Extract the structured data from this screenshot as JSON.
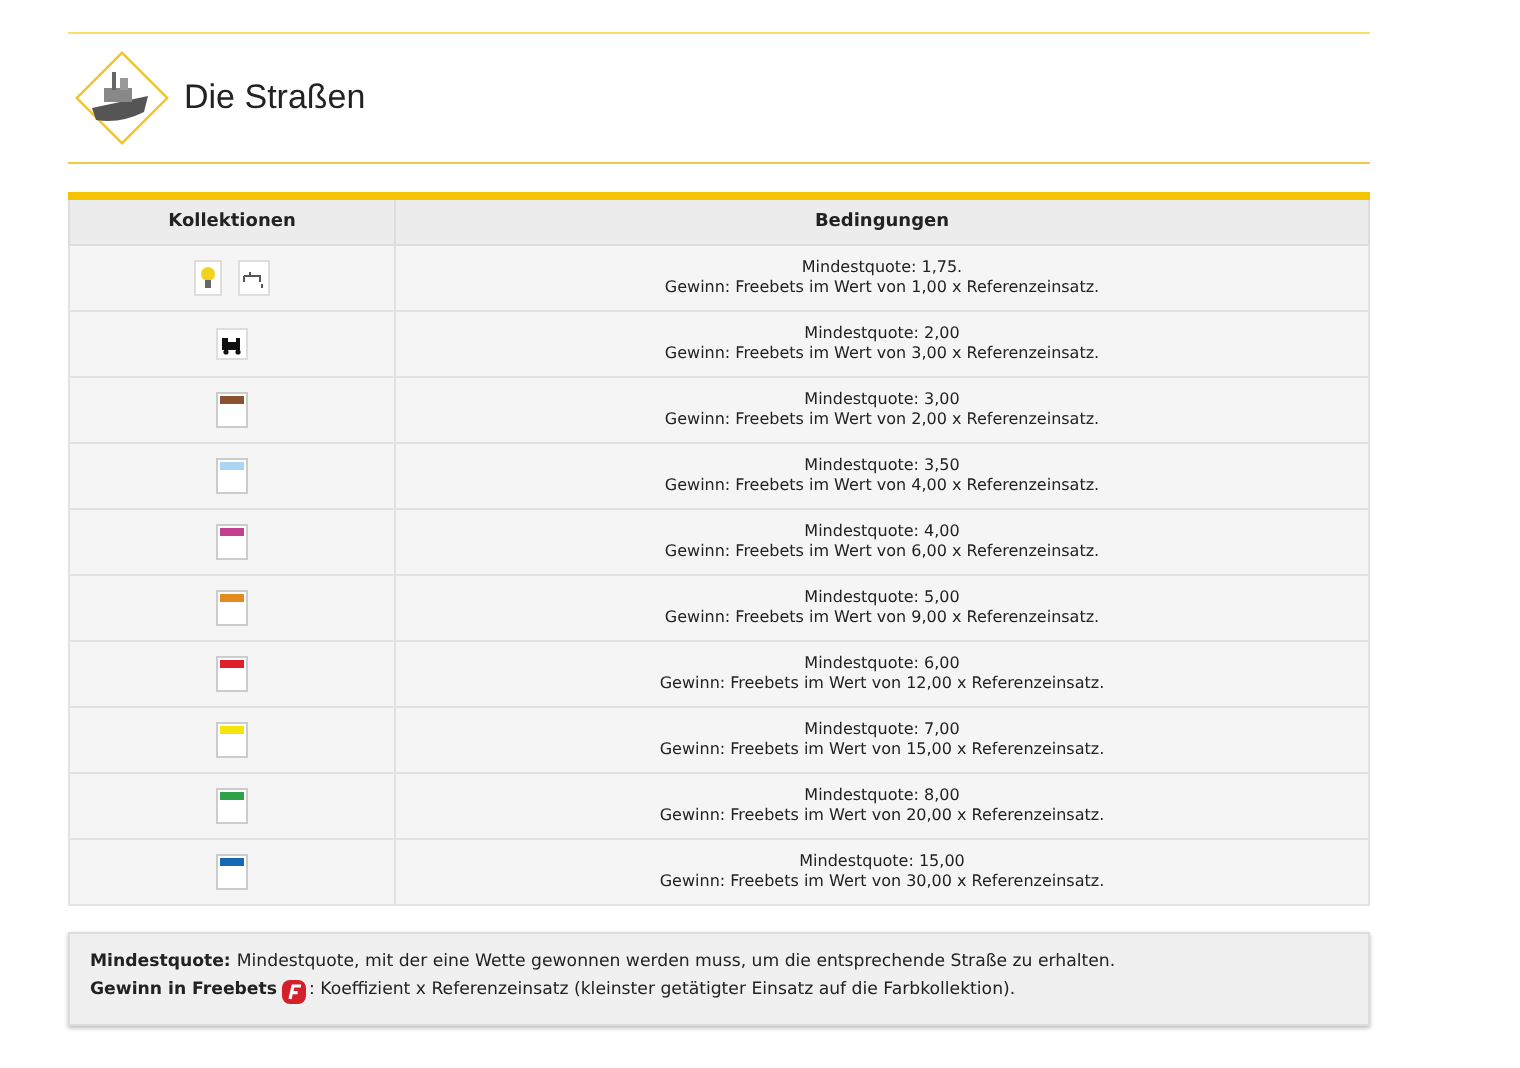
{
  "section": {
    "title": "Die Straßen"
  },
  "table": {
    "columns": [
      "Kollektionen",
      "Bedingungen"
    ],
    "rows": [
      {
        "kind": "icons",
        "line_1": "Mindestquote: 1,75.",
        "line_2": "Gewinn: Freebets im Wert von 1,00 x Referenzeinsatz."
      },
      {
        "kind": "train",
        "line_1": "Mindestquote: 2,00",
        "line_2": "Gewinn: Freebets im Wert von 3,00 x Referenzeinsatz."
      },
      {
        "kind": "card",
        "color": "#8b5230",
        "line_1": "Mindestquote: 3,00",
        "line_2": "Gewinn: Freebets im Wert von 2,00 x Referenzeinsatz."
      },
      {
        "kind": "card",
        "color": "#a9d4f2",
        "line_1": "Mindestquote: 3,50",
        "line_2": "Gewinn: Freebets im Wert von 4,00 x Referenzeinsatz."
      },
      {
        "kind": "card",
        "color": "#c2408f",
        "line_1": "Mindestquote: 4,00",
        "line_2": "Gewinn: Freebets im Wert von 6,00 x Referenzeinsatz."
      },
      {
        "kind": "card",
        "color": "#e58a1f",
        "line_1": "Mindestquote: 5,00",
        "line_2": "Gewinn: Freebets im Wert von 9,00 x Referenzeinsatz."
      },
      {
        "kind": "card",
        "color": "#e0202a",
        "line_1": "Mindestquote: 6,00",
        "line_2": "Gewinn: Freebets im Wert von 12,00 x Referenzeinsatz."
      },
      {
        "kind": "card",
        "color": "#f5e40a",
        "line_1": "Mindestquote: 7,00",
        "line_2": "Gewinn: Freebets im Wert von 15,00 x Referenzeinsatz."
      },
      {
        "kind": "card",
        "color": "#2ea24a",
        "line_1": "Mindestquote: 8,00",
        "line_2": "Gewinn: Freebets im Wert von 20,00 x Referenzeinsatz."
      },
      {
        "kind": "card",
        "color": "#1769b5",
        "line_1": "Mindestquote: 15,00",
        "line_2": "Gewinn: Freebets im Wert von 30,00 x Referenzeinsatz."
      }
    ]
  },
  "notes": [
    {
      "label": "Mindestquote:",
      "badge": false,
      "text": "Mindestquote, mit der eine Wette gewonnen werden muss, um die entsprechende Straße zu erhalten."
    },
    {
      "label": "Gewinn in Freebets",
      "badge": true,
      "text": ": Koeffizient x Referenzeinsatz (kleinster getätigter Einsatz auf die Farbkollektion)."
    }
  ]
}
